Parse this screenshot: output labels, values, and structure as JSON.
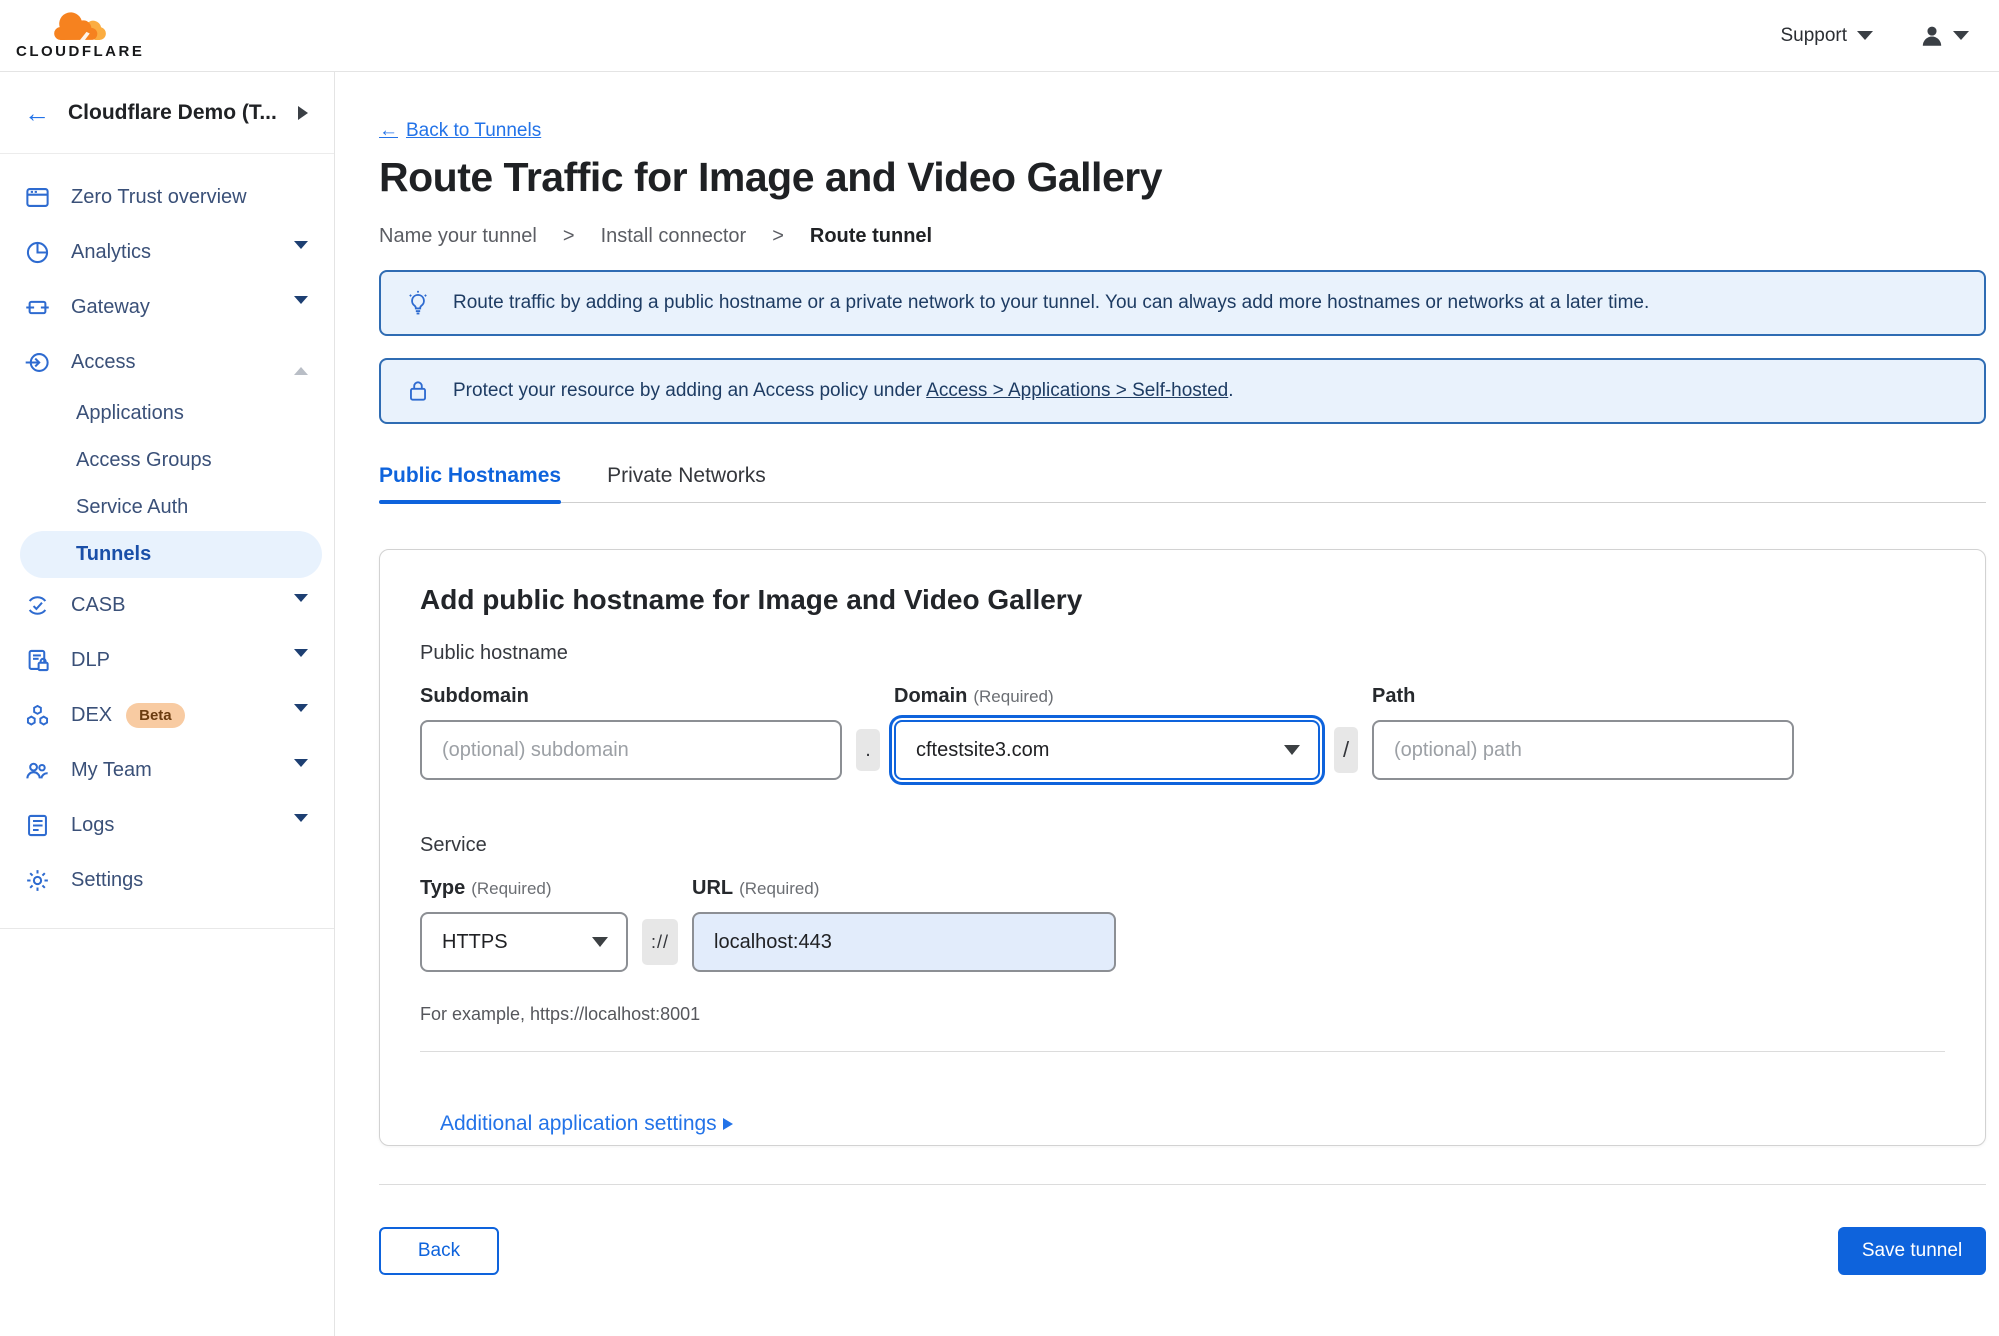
{
  "colors": {
    "accent": "#0e63dc",
    "link_blue": "#2373e8",
    "banner_bg": "#e9f2fc",
    "banner_border": "#2f6cb3",
    "banner_text": "#1e3c63",
    "sidebar_active_bg": "#e8f2fd",
    "beta_badge_bg": "#f8cba2",
    "url_input_bg": "#e2ecfb",
    "logo_orange": "#f6821f",
    "logo_orange_light": "#fbad41"
  },
  "topbar": {
    "brand": "CLOUDFLARE",
    "support_label": "Support"
  },
  "sidebar": {
    "account_name": "Cloudflare Demo (T...",
    "back_arrow": "←",
    "items": [
      {
        "label": "Zero Trust overview"
      },
      {
        "label": "Analytics"
      },
      {
        "label": "Gateway"
      },
      {
        "label": "Access",
        "children": [
          "Applications",
          "Access Groups",
          "Service Auth",
          "Tunnels"
        ],
        "active_child": "Tunnels"
      },
      {
        "label": "CASB"
      },
      {
        "label": "DLP"
      },
      {
        "label": "DEX",
        "badge": "Beta"
      },
      {
        "label": "My Team"
      },
      {
        "label": "Logs"
      },
      {
        "label": "Settings"
      }
    ]
  },
  "main": {
    "back_arrow": "←",
    "back_link_label": "Back to Tunnels",
    "title": "Route Traffic for Image and Video Gallery",
    "steps": [
      "Name your tunnel",
      "Install connector",
      "Route tunnel"
    ],
    "step_separator": ">",
    "banners": [
      {
        "icon": "lightbulb",
        "text": "Route traffic by adding a public hostname or a private network to your tunnel. You can always add more hostnames or networks at a later time."
      },
      {
        "icon": "lock",
        "text_prefix": "Protect your resource by adding an Access policy under ",
        "link": "Access > Applications > Self-hosted",
        "text_suffix": "."
      }
    ],
    "tabs": [
      {
        "label": "Public Hostnames",
        "active": true
      },
      {
        "label": "Private Networks",
        "active": false
      }
    ],
    "form": {
      "heading": "Add public hostname for Image and Video Gallery",
      "public_hostname_label": "Public hostname",
      "subdomain_label": "Subdomain",
      "domain_label": "Domain",
      "path_label": "Path",
      "required_label": "(Required)",
      "subdomain_placeholder": "(optional) subdomain",
      "domain_value": "cftestsite3.com",
      "path_placeholder": "(optional) path",
      "dot_separator": ".",
      "slash_separator": "/",
      "service_label": "Service",
      "type_label": "Type",
      "url_label": "URL",
      "type_value": "HTTPS",
      "scheme_separator": "://",
      "url_value": "localhost:443",
      "example_text": "For example, https://localhost:8001",
      "additional_settings_label": "Additional application settings"
    },
    "footer": {
      "back_label": "Back",
      "save_label": "Save tunnel"
    }
  }
}
